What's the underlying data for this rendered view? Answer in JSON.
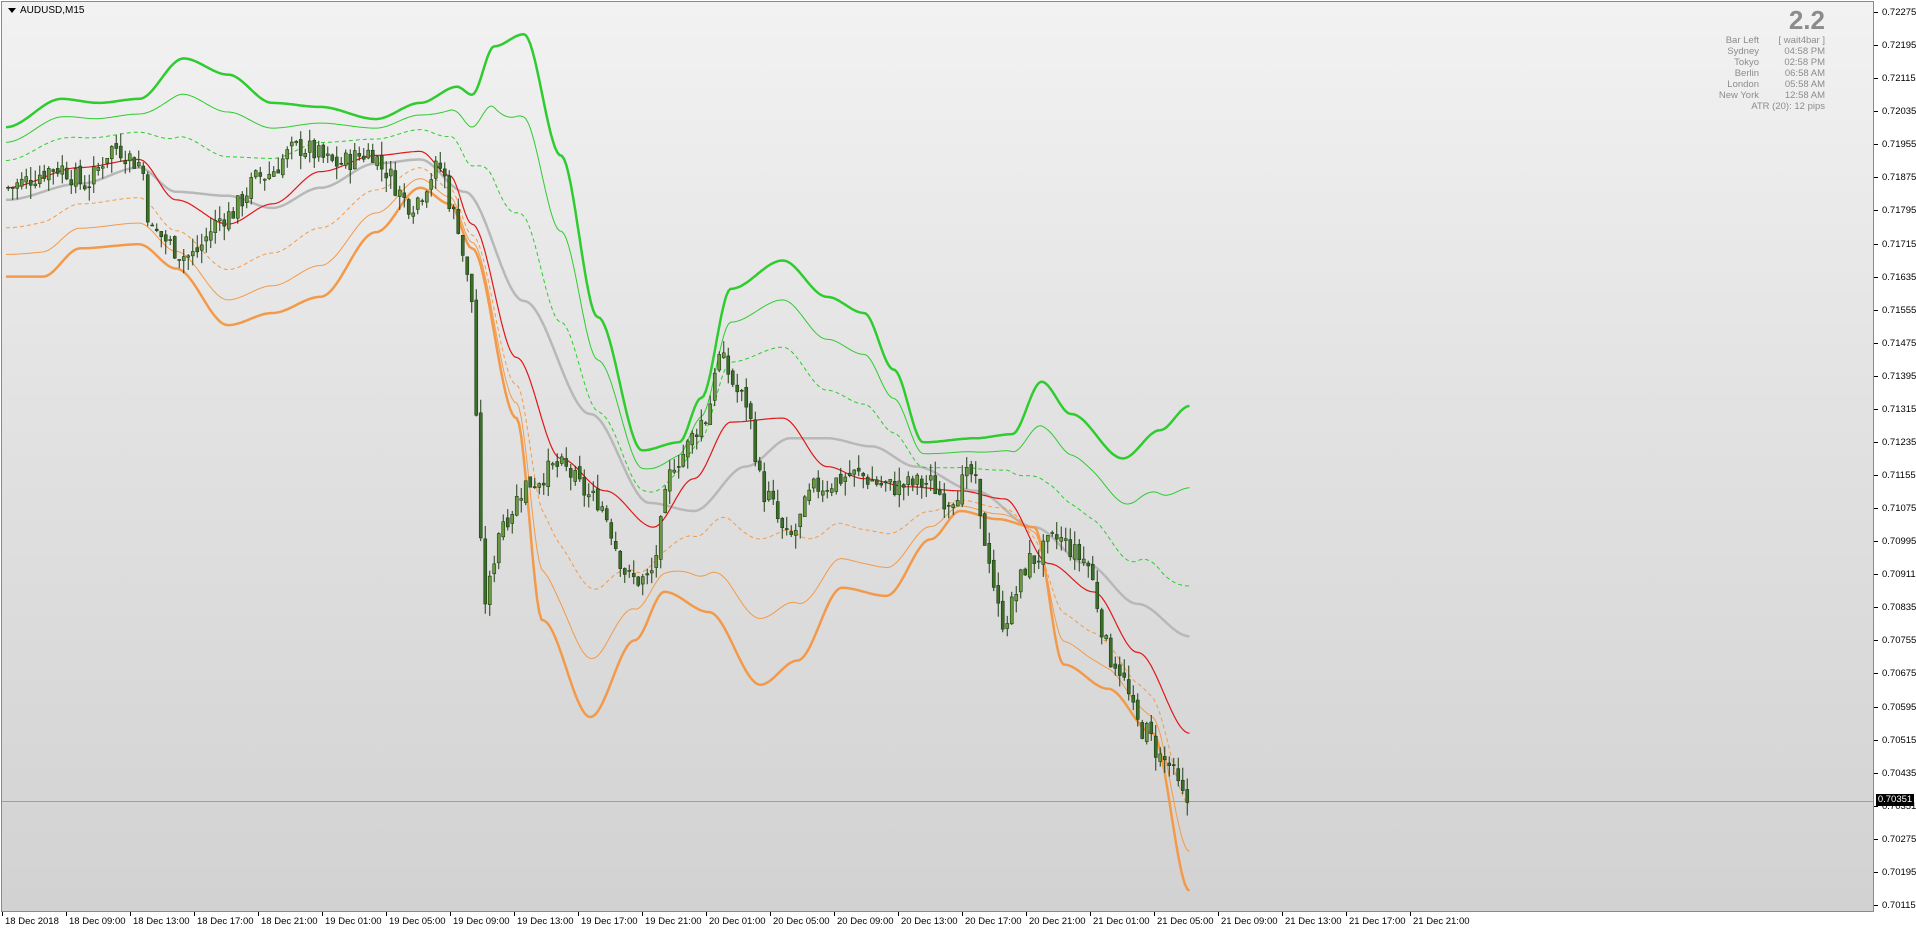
{
  "symbol": "AUDUSD,M15",
  "info": {
    "value": "2.2",
    "rows": [
      {
        "k": "Bar Left",
        "v": "[ wait4bar ]"
      },
      {
        "k": "Sydney",
        "v": "04:58 PM"
      },
      {
        "k": "Tokyo",
        "v": "02:58 PM"
      },
      {
        "k": "Berlin",
        "v": "06:58 AM"
      },
      {
        "k": "London",
        "v": "05:58 AM"
      },
      {
        "k": "New York",
        "v": "12:58 AM"
      }
    ],
    "atr": "ATR (20): 12 pips"
  },
  "current_price": "0.70351",
  "colors": {
    "upper_band": "#2ecc2e",
    "lower_band": "#f39a4a",
    "mid_red": "#e01818",
    "mid_gray": "#b8b8b8",
    "candle": "#3b6e2a"
  },
  "chart_data": {
    "type": "candlestick",
    "price_ticks": [
      "0.72275",
      "0.72195",
      "0.72115",
      "0.72035",
      "0.71955",
      "0.71875",
      "0.71795",
      "0.71715",
      "0.71635",
      "0.71555",
      "0.71475",
      "0.71395",
      "0.71315",
      "0.71235",
      "0.71155",
      "0.71075",
      "0.70995",
      "0.70911",
      "0.70835",
      "0.70755",
      "0.70675",
      "0.70595",
      "0.70515",
      "0.70435",
      "0.70351",
      "0.70275",
      "0.70195",
      "0.70115"
    ],
    "time_ticks": [
      "18 Dec 2018",
      "18 Dec 09:00",
      "18 Dec 13:00",
      "18 Dec 17:00",
      "18 Dec 21:00",
      "19 Dec 01:00",
      "19 Dec 05:00",
      "19 Dec 09:00",
      "19 Dec 13:00",
      "19 Dec 17:00",
      "19 Dec 21:00",
      "20 Dec 01:00",
      "20 Dec 05:00",
      "20 Dec 09:00",
      "20 Dec 13:00",
      "20 Dec 17:00",
      "20 Dec 21:00",
      "21 Dec 01:00",
      "21 Dec 05:00",
      "21 Dec 09:00",
      "21 Dec 13:00",
      "21 Dec 17:00",
      "21 Dec 21:00"
    ],
    "ylim": [
      0.7009,
      0.723
    ],
    "bar_count": 292,
    "close_path": [
      [
        0,
        0.7187
      ],
      [
        15,
        0.7192
      ],
      [
        22,
        0.7188
      ],
      [
        30,
        0.7197
      ],
      [
        37,
        0.7193
      ],
      [
        40,
        0.7176
      ],
      [
        50,
        0.717
      ],
      [
        60,
        0.718
      ],
      [
        70,
        0.719
      ],
      [
        80,
        0.7197
      ],
      [
        90,
        0.7193
      ],
      [
        100,
        0.7196
      ],
      [
        102,
        0.7192
      ],
      [
        110,
        0.7183
      ],
      [
        118,
        0.7192
      ],
      [
        122,
        0.718
      ],
      [
        126,
        0.7163
      ],
      [
        130,
        0.7085
      ],
      [
        135,
        0.7105
      ],
      [
        142,
        0.7114
      ],
      [
        150,
        0.7118
      ],
      [
        160,
        0.711
      ],
      [
        170,
        0.709
      ],
      [
        174,
        0.709
      ],
      [
        182,
        0.712
      ],
      [
        190,
        0.713
      ],
      [
        193,
        0.7145
      ],
      [
        200,
        0.7135
      ],
      [
        206,
        0.7111
      ],
      [
        212,
        0.71
      ],
      [
        220,
        0.7113
      ],
      [
        230,
        0.7116
      ],
      [
        240,
        0.7113
      ],
      [
        250,
        0.7114
      ],
      [
        255,
        0.711
      ],
      [
        262,
        0.7116
      ],
      [
        265,
        0.71
      ],
      [
        270,
        0.708
      ],
      [
        278,
        0.7095
      ],
      [
        285,
        0.71
      ],
      [
        292,
        0.70951
      ],
      [
        300,
        0.707
      ],
      [
        308,
        0.7053
      ],
      [
        314,
        0.7045
      ],
      [
        320,
        0.70351
      ]
    ],
    "upper_band": [
      [
        0,
        0.7202
      ],
      [
        15,
        0.7209
      ],
      [
        25,
        0.7208
      ],
      [
        36,
        0.7209
      ],
      [
        48,
        0.7219
      ],
      [
        60,
        0.7215
      ],
      [
        72,
        0.7208
      ],
      [
        85,
        0.7207
      ],
      [
        100,
        0.7204
      ],
      [
        112,
        0.7208
      ],
      [
        122,
        0.7212
      ],
      [
        126,
        0.721
      ],
      [
        132,
        0.7222
      ],
      [
        140,
        0.7225
      ],
      [
        150,
        0.7195
      ],
      [
        160,
        0.7155
      ],
      [
        172,
        0.7122
      ],
      [
        182,
        0.7124
      ],
      [
        188,
        0.7135
      ],
      [
        196,
        0.7162
      ],
      [
        210,
        0.7169
      ],
      [
        222,
        0.716
      ],
      [
        232,
        0.7156
      ],
      [
        240,
        0.7142
      ],
      [
        248,
        0.7124
      ],
      [
        262,
        0.7125
      ],
      [
        272,
        0.7126
      ],
      [
        280,
        0.7139
      ],
      [
        288,
        0.7131
      ],
      [
        302,
        0.712
      ],
      [
        312,
        0.7127
      ],
      [
        320,
        0.7133
      ]
    ],
    "lower_band": [
      [
        0,
        0.7165
      ],
      [
        10,
        0.7165
      ],
      [
        20,
        0.7172
      ],
      [
        36,
        0.7173
      ],
      [
        46,
        0.7167
      ],
      [
        60,
        0.7153
      ],
      [
        72,
        0.7156
      ],
      [
        85,
        0.716
      ],
      [
        100,
        0.7176
      ],
      [
        112,
        0.7187
      ],
      [
        120,
        0.7183
      ],
      [
        126,
        0.7172
      ],
      [
        138,
        0.713
      ],
      [
        145,
        0.708
      ],
      [
        158,
        0.7056
      ],
      [
        170,
        0.7075
      ],
      [
        178,
        0.7087
      ],
      [
        190,
        0.7082
      ],
      [
        204,
        0.7064
      ],
      [
        214,
        0.707
      ],
      [
        226,
        0.7088
      ],
      [
        238,
        0.7086
      ],
      [
        250,
        0.71
      ],
      [
        258,
        0.7107
      ],
      [
        268,
        0.7105
      ],
      [
        278,
        0.7103
      ],
      [
        286,
        0.7069
      ],
      [
        298,
        0.7063
      ],
      [
        310,
        0.7052
      ],
      [
        320,
        0.7013
      ]
    ],
    "mid_red": [
      [
        0,
        0.7187
      ],
      [
        20,
        0.7192
      ],
      [
        36,
        0.7194
      ],
      [
        46,
        0.7184
      ],
      [
        60,
        0.7178
      ],
      [
        72,
        0.7183
      ],
      [
        85,
        0.7191
      ],
      [
        100,
        0.7195
      ],
      [
        112,
        0.7196
      ],
      [
        120,
        0.719
      ],
      [
        126,
        0.7178
      ],
      [
        138,
        0.7145
      ],
      [
        150,
        0.712
      ],
      [
        162,
        0.7112
      ],
      [
        175,
        0.7103
      ],
      [
        186,
        0.7115
      ],
      [
        196,
        0.7129
      ],
      [
        210,
        0.713
      ],
      [
        222,
        0.7118
      ],
      [
        232,
        0.7115
      ],
      [
        244,
        0.7113
      ],
      [
        258,
        0.7112
      ],
      [
        270,
        0.711
      ],
      [
        282,
        0.7094
      ],
      [
        294,
        0.7087
      ],
      [
        306,
        0.7072
      ],
      [
        320,
        0.7052
      ]
    ],
    "mid_gray": [
      [
        0,
        0.7184
      ],
      [
        20,
        0.7188
      ],
      [
        36,
        0.7192
      ],
      [
        46,
        0.7186
      ],
      [
        60,
        0.7185
      ],
      [
        72,
        0.7182
      ],
      [
        85,
        0.7187
      ],
      [
        100,
        0.7193
      ],
      [
        112,
        0.7194
      ],
      [
        124,
        0.7186
      ],
      [
        140,
        0.7159
      ],
      [
        158,
        0.7131
      ],
      [
        174,
        0.7109
      ],
      [
        186,
        0.7107
      ],
      [
        200,
        0.7118
      ],
      [
        212,
        0.7125
      ],
      [
        222,
        0.7125
      ],
      [
        234,
        0.7123
      ],
      [
        246,
        0.7118
      ],
      [
        262,
        0.7112
      ],
      [
        278,
        0.7103
      ],
      [
        292,
        0.7094
      ],
      [
        306,
        0.7084
      ],
      [
        320,
        0.7076
      ]
    ]
  }
}
